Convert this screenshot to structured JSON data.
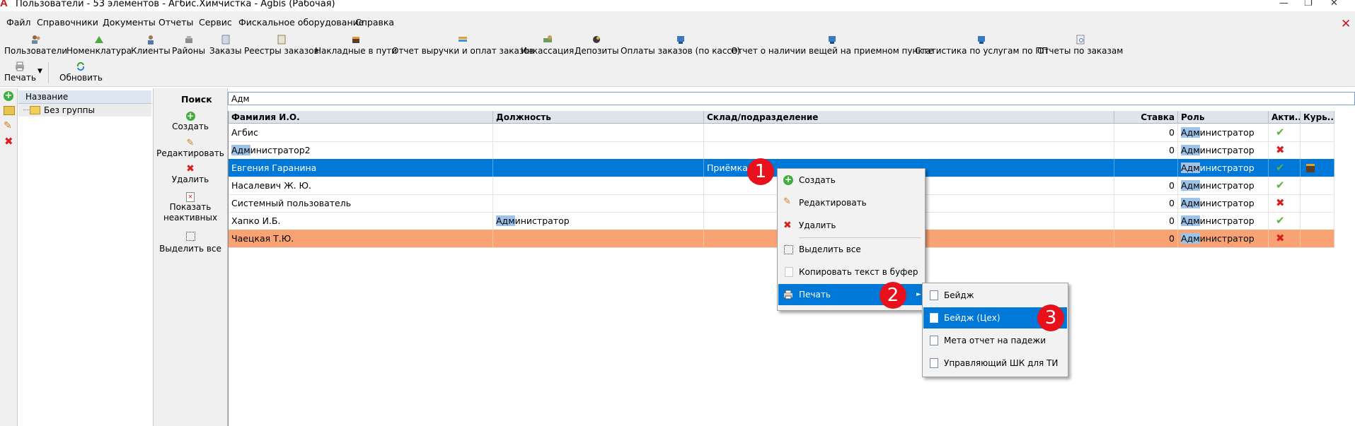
{
  "window": {
    "title": "Пользователи - 53 элементов - Агбис.Химчистка - Agbis (Рабочая)",
    "logo": "A",
    "minimize": "—",
    "restore": "❐",
    "close": "✕"
  },
  "menu": [
    "Файл",
    "Справочники",
    "Документы",
    "Отчеты",
    "Сервис",
    "Фискальное оборудование",
    "Справка"
  ],
  "menu_close": "✕",
  "toolbar": [
    {
      "label": "Пользователи",
      "icon": "users-icon"
    },
    {
      "label": "Номенклатура",
      "icon": "nomenclature-icon"
    },
    {
      "label": "Клиенты",
      "icon": "clients-icon"
    },
    {
      "label": "Районы",
      "icon": "districts-icon"
    },
    {
      "label": "Заказы",
      "icon": "orders-icon"
    },
    {
      "label": "Реестры заказов",
      "icon": "order-registry-icon"
    },
    {
      "label": "Накладные в пути",
      "icon": "waybills-icon"
    },
    {
      "label": "Отчет выручки и оплат заказов",
      "icon": "revenue-report-icon"
    },
    {
      "label": "Инкассация",
      "icon": "collection-icon"
    },
    {
      "label": "Депозиты",
      "icon": "deposits-icon"
    },
    {
      "label": "Оплаты заказов (по кассе)",
      "icon": "payments-icon"
    },
    {
      "label": "Отчет о наличии вещей на приемном пункте",
      "icon": "items-report-icon"
    },
    {
      "label": "Статистика по услугам по ПП",
      "icon": "statistics-icon"
    },
    {
      "label": "Отчеты по заказам",
      "icon": "order-reports-icon"
    }
  ],
  "toolbar2": {
    "print": "Печать",
    "refresh": "Обновить"
  },
  "tree": {
    "header": "Название",
    "root": "Без группы"
  },
  "actions": {
    "create": "Создать",
    "edit": "Редактировать",
    "delete": "Удалить",
    "show_inactive_1": "Показать",
    "show_inactive_2": "неактивных",
    "select_all": "Выделить все"
  },
  "search": {
    "label": "Поиск",
    "value": "Адм"
  },
  "grid": {
    "columns": [
      "Фамилия И.О.",
      "Должность",
      "Склад/подразделение",
      "Ставка",
      "Роль",
      "Акти...",
      "Курь..."
    ],
    "rows": [
      {
        "name": "Агбис",
        "position": "",
        "warehouse": "",
        "rate": "0",
        "role_hl": "Адм",
        "role_rest": "инистратор",
        "active": "✔",
        "courier": ""
      },
      {
        "name_hl": "Адм",
        "name": "инистратор2",
        "position": "",
        "warehouse": "",
        "rate": "0",
        "role_hl": "Адм",
        "role_rest": "инистратор",
        "active": "✖",
        "courier": ""
      },
      {
        "name": "Евгения Гаранина",
        "position": "",
        "warehouse": "Приёмка",
        "rate": "",
        "role_hl": "Адм",
        "role_rest": "инистратор",
        "active": "✔",
        "courier": "courier-icon"
      },
      {
        "name": "Насалевич Ж. Ю.",
        "position": "",
        "warehouse": "",
        "rate": "0",
        "role_hl": "Адм",
        "role_rest": "инистратор",
        "active": "✔",
        "courier": ""
      },
      {
        "name": "Системный пользователь",
        "position": "",
        "warehouse": "",
        "rate": "0",
        "role_hl": "Адм",
        "role_rest": "инистратор",
        "active": "✖",
        "courier": ""
      },
      {
        "name": "Хапко И.Б.",
        "position_hl": "Адм",
        "position": "инистратор",
        "warehouse": "",
        "rate": "0",
        "role_hl": "Адм",
        "role_rest": "инистратор",
        "active": "✔",
        "courier": ""
      },
      {
        "name": "Чаецкая Т.Ю.",
        "position": "",
        "warehouse": "",
        "rate": "0",
        "role_hl": "Адм",
        "role_rest": "инистратор",
        "active": "✖",
        "courier": ""
      }
    ]
  },
  "context_menu": {
    "items": [
      "Создать",
      "Редактировать",
      "Удалить",
      "Выделить все",
      "Копировать текст в буфер",
      "Печать"
    ]
  },
  "print_submenu": {
    "items": [
      "Бейдж",
      "Бейдж (Цех)",
      "Мета отчет на падежи",
      "Управляющий ШК для ТИ"
    ]
  },
  "badges": [
    "1",
    "2",
    "3"
  ],
  "colors": {
    "selection": "#0078d7",
    "orange_row": "#f9a375",
    "badge": "#e8101a",
    "check": "#55b53c",
    "cross": "#d81e1e"
  }
}
